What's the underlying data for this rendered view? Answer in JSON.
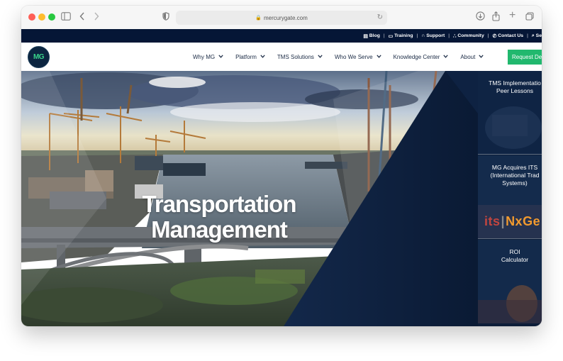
{
  "browser": {
    "url": "mercurygate.com"
  },
  "topbar": {
    "links": [
      {
        "icon": "book-icon",
        "label": "Blog"
      },
      {
        "icon": "monitor-icon",
        "label": "Training"
      },
      {
        "icon": "headset-icon",
        "label": "Support"
      },
      {
        "icon": "people-icon",
        "label": "Community"
      },
      {
        "icon": "phone-icon",
        "label": "Contact Us"
      },
      {
        "icon": "search-icon",
        "label": "Se"
      }
    ]
  },
  "nav": {
    "logo_text": "MG",
    "items": [
      "Why MG",
      "Platform",
      "TMS Solutions",
      "Who We Serve",
      "Knowledge Center",
      "About"
    ],
    "cta_label": "Request Dem"
  },
  "hero": {
    "title_line1": "Transportation",
    "title_line2": "Management"
  },
  "cards": [
    {
      "title": "TMS Implementatio\nPeer Lessons"
    },
    {
      "title": "MG Acquires ITS\n(International Trad\nSystems)",
      "brand_its": "its",
      "brand_sep": "|",
      "brand_nxge": "NxGe"
    },
    {
      "title": "ROI\nCalculator"
    }
  ],
  "colors": {
    "topbar_bg": "#051636",
    "cta_bg": "#21b86e",
    "navy_overlay": "#0c1d38"
  }
}
